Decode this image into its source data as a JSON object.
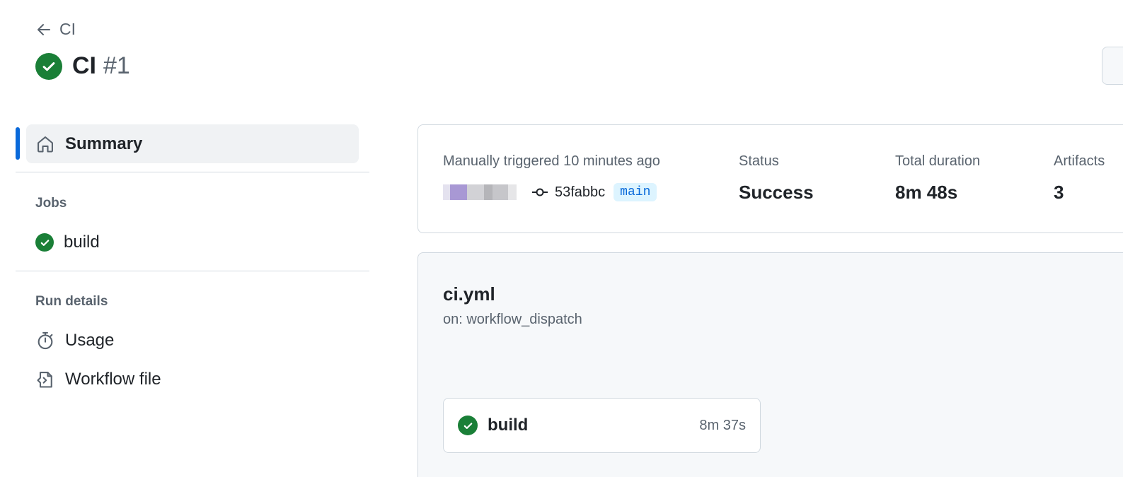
{
  "header": {
    "back_label": "CI",
    "title": "CI",
    "run_number": "#1"
  },
  "sidebar": {
    "summary_label": "Summary",
    "jobs_heading": "Jobs",
    "jobs": [
      {
        "label": "build",
        "status": "success"
      }
    ],
    "run_details_heading": "Run details",
    "run_details": [
      {
        "label": "Usage",
        "icon": "stopwatch-icon"
      },
      {
        "label": "Workflow file",
        "icon": "file-code-icon"
      }
    ]
  },
  "summary": {
    "trigger_text": "Manually triggered 10 minutes ago",
    "commit_sha": "53fabbc",
    "branch": "main",
    "status_label": "Status",
    "status_value": "Success",
    "duration_label": "Total duration",
    "duration_value": "8m 48s",
    "artifacts_label": "Artifacts",
    "artifacts_value": "3"
  },
  "workflow": {
    "file_name": "ci.yml",
    "trigger": "on: workflow_dispatch",
    "jobs": [
      {
        "name": "build",
        "duration": "8m 37s",
        "status": "success"
      }
    ]
  },
  "colors": {
    "success": "#1a7f37",
    "accent": "#0969da",
    "muted_text": "#59636e",
    "border": "#d1d9e0"
  }
}
